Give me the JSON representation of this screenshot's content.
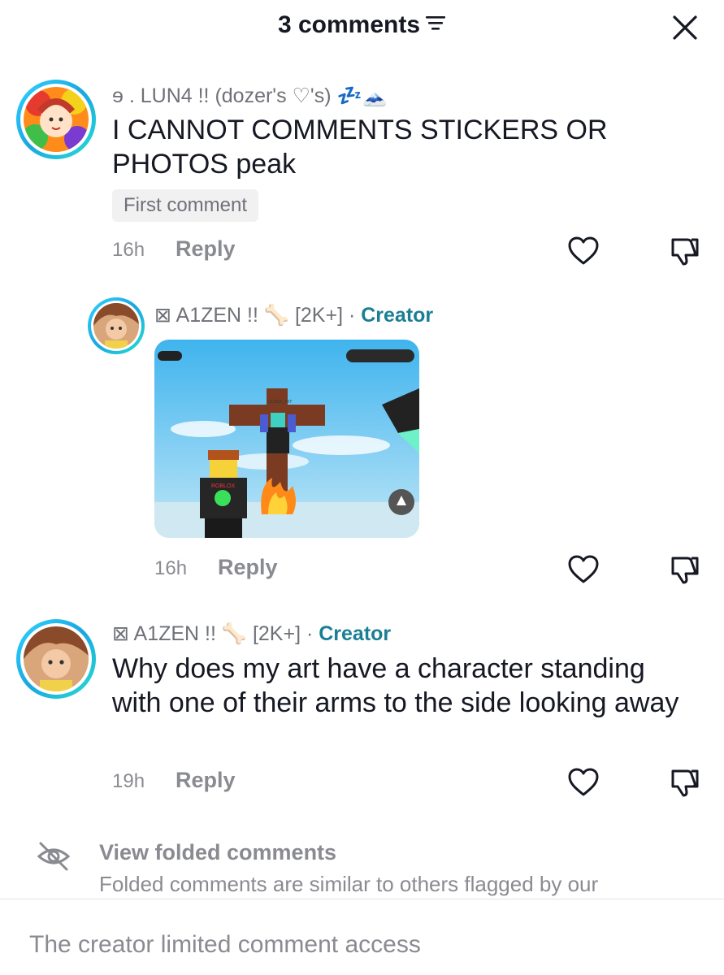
{
  "header": {
    "title": "3 comments"
  },
  "comments": [
    {
      "username": "ɘ . LUN4 !! (dozer's ♡'s) 💤🗻",
      "text": "I CANNOT COMMENTS STICKERS OR PHOTOS peak",
      "badge": "First comment",
      "time": "16h",
      "reply": "Reply"
    },
    {
      "username": "⊠ A1ZEN !! 🦴 [2K+] ·",
      "creator": "Creator",
      "time": "16h",
      "reply": "Reply",
      "photo_texts": {
        "nametag": "CLOCK_TXT",
        "shirt": "ROBLOX"
      }
    },
    {
      "username": "⊠ A1ZEN !! 🦴 [2K+] ·",
      "creator": "Creator",
      "text": "Why does my art have a character standing with one of their arms to the side looking away",
      "time": "19h",
      "reply": "Reply"
    }
  ],
  "folded": {
    "title": "View folded comments",
    "description": "Folded comments are similar to others flagged by our"
  },
  "footer": {
    "text": "The creator limited comment access"
  },
  "colors": {
    "creator": "#1a7f94",
    "muted": "#8a8b91",
    "avatar_ring": "#2fd4ff"
  },
  "icons": [
    "sort-icon",
    "close-icon",
    "heart-icon",
    "dislike-icon",
    "eye-slash-icon"
  ]
}
